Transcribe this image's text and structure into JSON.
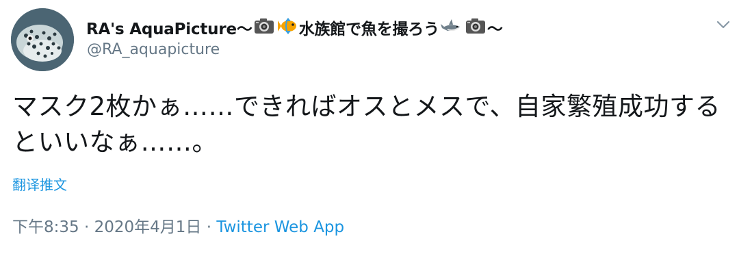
{
  "user": {
    "display_name_prefix": "RA's AquaPicture～",
    "display_name_middle": "水族館で魚を撮ろう",
    "display_name_suffix": "～",
    "handle": "@RA_aquapicture",
    "avatar_icon": "moray-eel-avatar"
  },
  "tweet": {
    "text": "マスク2枚かぁ……できればオスとメスで、自家繁殖成功するといいなぁ……。",
    "translate_label": "翻译推文",
    "time": "下午8:35",
    "date": "2020年4月1日",
    "separator": "·",
    "source": "Twitter Web App"
  },
  "icons": {
    "camera": "camera-icon",
    "fish": "tropical-fish-icon",
    "shark": "shark-icon",
    "menu": "chevron-down-icon"
  },
  "colors": {
    "text": "#14171a",
    "secondary": "#657786",
    "link": "#1b95e0"
  }
}
